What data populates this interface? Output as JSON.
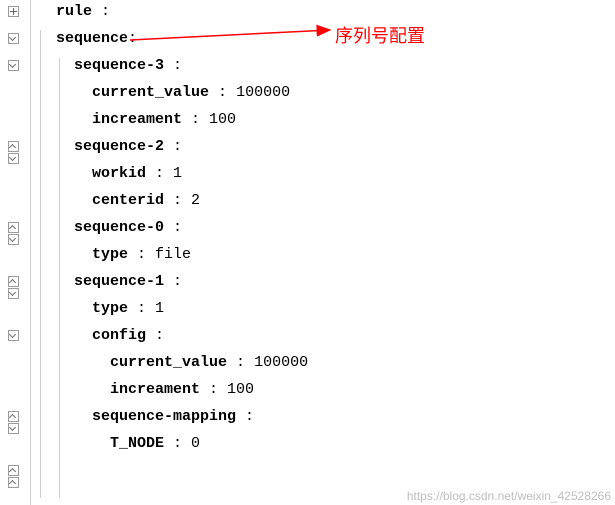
{
  "lines": [
    {
      "indent": 2,
      "key": "rule",
      "value": ""
    },
    {
      "indent": 2,
      "key": "sequence",
      "value": ""
    },
    {
      "indent": 4,
      "key": "sequence-3",
      "value": ""
    },
    {
      "indent": 6,
      "key": "current_value",
      "value": "100000"
    },
    {
      "indent": 6,
      "key": "increament",
      "value": "100"
    },
    {
      "indent": 4,
      "key": "sequence-2",
      "value": ""
    },
    {
      "indent": 6,
      "key": "workid",
      "value": "1"
    },
    {
      "indent": 6,
      "key": "centerid",
      "value": "2"
    },
    {
      "indent": 4,
      "key": "sequence-0",
      "value": ""
    },
    {
      "indent": 6,
      "key": "type",
      "value": "file"
    },
    {
      "indent": 4,
      "key": "sequence-1",
      "value": ""
    },
    {
      "indent": 6,
      "key": "type",
      "value": "1"
    },
    {
      "indent": 6,
      "key": "config",
      "value": ""
    },
    {
      "indent": 8,
      "key": "current_value",
      "value": "100000"
    },
    {
      "indent": 8,
      "key": "increament",
      "value": "100"
    },
    {
      "indent": 6,
      "key": "sequence-mapping",
      "value": ""
    },
    {
      "indent": 8,
      "key": "T_NODE",
      "value": "0"
    }
  ],
  "annotation": {
    "text": "序列号配置"
  },
  "watermark": {
    "text": "https://blog.csdn.net/weixin_42528266"
  },
  "gutter": [
    {
      "row": 0,
      "kind": "plus"
    },
    {
      "row": 1,
      "kind": "chevron"
    },
    {
      "row": 2,
      "kind": "chevron"
    },
    {
      "row": 5,
      "kind": "close"
    },
    {
      "row": 5,
      "kind": "chevron",
      "offset": 1
    },
    {
      "row": 8,
      "kind": "close"
    },
    {
      "row": 8,
      "kind": "chevron",
      "offset": 1
    },
    {
      "row": 10,
      "kind": "close"
    },
    {
      "row": 10,
      "kind": "chevron",
      "offset": 1
    },
    {
      "row": 12,
      "kind": "chevron"
    },
    {
      "row": 15,
      "kind": "close"
    },
    {
      "row": 15,
      "kind": "chevron",
      "offset": 1
    },
    {
      "row": 17,
      "kind": "close"
    },
    {
      "row": 17,
      "kind": "close",
      "offset": 1
    }
  ]
}
